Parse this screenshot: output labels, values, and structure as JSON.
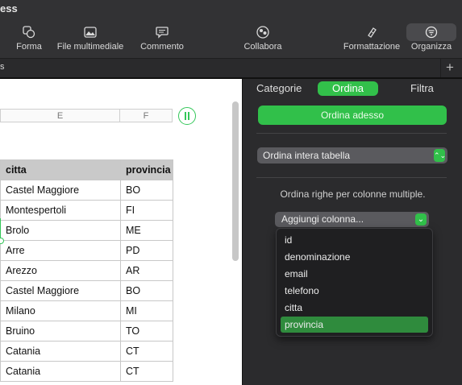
{
  "window": {
    "title_fragment": "ess"
  },
  "toolbar": {
    "items": [
      {
        "label": "Forma",
        "icon": "shape-icon"
      },
      {
        "label": "File multimediale",
        "icon": "media-icon"
      },
      {
        "label": "Commento",
        "icon": "comment-icon"
      },
      {
        "label": "Collabora",
        "icon": "collaborate-icon"
      },
      {
        "label": "Formattazione",
        "icon": "paintbrush-icon"
      },
      {
        "label": "Organizza",
        "icon": "organize-icon",
        "active": true
      }
    ]
  },
  "tabstrip": {
    "sheet_tab_fragment": "s",
    "add_label": "+"
  },
  "sheet": {
    "column_headers": [
      "E",
      "F"
    ],
    "table": {
      "headers": [
        "citta",
        "provincia"
      ],
      "rows": [
        [
          "Castel Maggiore",
          "BO"
        ],
        [
          "Montespertoli",
          "FI"
        ],
        [
          "Brolo",
          "ME"
        ],
        [
          "Arre",
          "PD"
        ],
        [
          "Arezzo",
          "AR"
        ],
        [
          "Castel Maggiore",
          "BO"
        ],
        [
          "Milano",
          "MI"
        ],
        [
          "Bruino",
          "TO"
        ],
        [
          "Catania",
          "CT"
        ],
        [
          "Catania",
          "CT"
        ]
      ]
    }
  },
  "panel": {
    "tabs": [
      "Categorie",
      "Ordina",
      "Filtra"
    ],
    "active_tab": "Ordina",
    "sort_now_label": "Ordina adesso",
    "scope_select": "Ordina intera tabella",
    "hint": "Ordina righe per colonne multiple.",
    "add_column_label": "Aggiungi colonna...",
    "menu_options": [
      "id",
      "denominazione",
      "email",
      "telefono",
      "citta",
      "provincia"
    ],
    "menu_selected": "provincia"
  },
  "colors": {
    "accent_green": "#31c04a",
    "menu_selected": "#2f8b3d"
  }
}
